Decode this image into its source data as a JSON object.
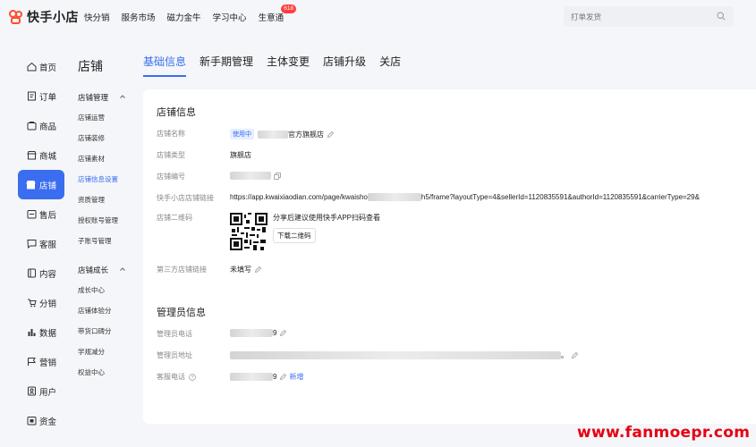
{
  "header": {
    "logo_text": "快手小店",
    "nav": [
      "快分销",
      "服务市场",
      "磁力金牛",
      "学习中心",
      "生意通"
    ],
    "nav_badge": "618",
    "search_placeholder": "打单发货"
  },
  "sidebar": {
    "items": [
      {
        "label": "首页",
        "icon": "home-icon"
      },
      {
        "label": "订单",
        "icon": "order-icon"
      },
      {
        "label": "商品",
        "icon": "goods-icon"
      },
      {
        "label": "商城",
        "icon": "mall-icon"
      },
      {
        "label": "店铺",
        "icon": "store-icon"
      },
      {
        "label": "售后",
        "icon": "after-sale-icon"
      },
      {
        "label": "客服",
        "icon": "customer-service-icon"
      },
      {
        "label": "内容",
        "icon": "content-icon"
      },
      {
        "label": "分销",
        "icon": "distribution-icon"
      },
      {
        "label": "数据",
        "icon": "data-icon"
      },
      {
        "label": "营销",
        "icon": "marketing-icon"
      },
      {
        "label": "用户",
        "icon": "user-icon"
      },
      {
        "label": "资金",
        "icon": "funds-icon"
      }
    ],
    "active": "店铺"
  },
  "submenu": {
    "title": "店铺",
    "group1": "店铺管理",
    "group1_items": [
      "店铺运营",
      "店铺装修",
      "店铺素材",
      "店铺信息设置",
      "资质管理",
      "授权账号管理",
      "子账号管理"
    ],
    "group2": "店铺成长",
    "group2_items": [
      "成长中心",
      "店铺体验分",
      "带货口碑分",
      "学规减分",
      "权益中心"
    ],
    "active": "店铺信息设置"
  },
  "tabs": [
    "基础信息",
    "新手期管理",
    "主体变更",
    "店铺升级",
    "关店"
  ],
  "store_info": {
    "section_title": "店铺信息",
    "name_label": "店铺名称",
    "name_tag": "使用中",
    "name_value": "官方旗舰店",
    "type_label": "店铺类型",
    "type_value": "旗舰店",
    "id_label": "店铺编号",
    "link_label": "快手小店店铺链接",
    "link_value_prefix": "https://app.kwaixiaodian.com/page/kwaisho",
    "link_value_suffix": "h5/frame?layoutType=4&sellerId=1120835591&authorId=1120835591&carrierType=29&",
    "qr_label": "店铺二维码",
    "qr_text": "分享后建议使用快手APP扫码查看",
    "qr_download": "下载二维码",
    "third_label": "第三方店铺链接",
    "third_value": "未填写"
  },
  "admin_info": {
    "section_title": "管理员信息",
    "phone_label": "管理员电话",
    "phone_tail": "9",
    "addr_label": "管理员地址",
    "addr_tail": "。",
    "cs_label": "客服电话",
    "cs_tail": "9",
    "cs_add": "新增"
  },
  "watermark": "www.fanmoepr.com",
  "colors": {
    "accent": "#3a6df0",
    "brand": "#ff4d2d",
    "badge": "#ff3d3d"
  }
}
